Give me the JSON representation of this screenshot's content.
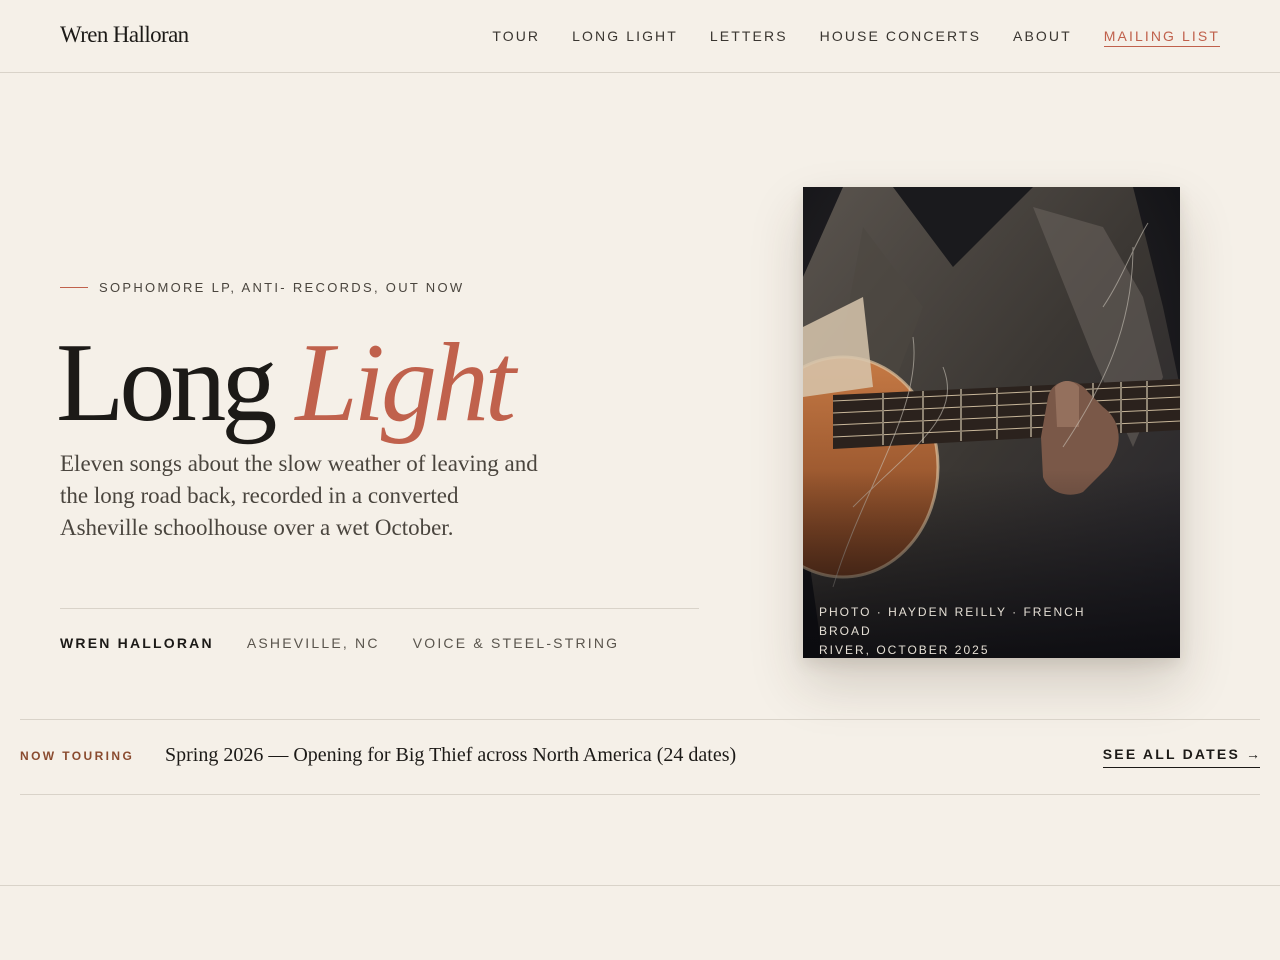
{
  "header": {
    "brand": "Wren Halloran",
    "nav": [
      {
        "label": "TOUR"
      },
      {
        "label": "LONG LIGHT"
      },
      {
        "label": "LETTERS"
      },
      {
        "label": "HOUSE CONCERTS"
      },
      {
        "label": "ABOUT"
      },
      {
        "label": "MAILING LIST"
      }
    ]
  },
  "hero": {
    "eyebrow": "SOPHOMORE LP, ANTI- RECORDS, OUT NOW",
    "title_main": "Long",
    "title_accent": "Light",
    "description": "Eleven songs about the slow weather of leaving and the long road back, recorded in a converted Asheville schoolhouse over a wet October.",
    "meta": {
      "artist": "WREN HALLORAN",
      "location": "ASHEVILLE, NC",
      "instrument": "VOICE & STEEL-STRING"
    }
  },
  "photo": {
    "credit_line1": "PHOTO · HAYDEN REILLY · FRENCH BROAD",
    "credit_line2": "RIVER, OCTOBER 2025"
  },
  "tour": {
    "label": "NOW TOURING",
    "text": "Spring 2026 — Opening for Big Thief across North America (24 dates)",
    "link": "SEE ALL DATES",
    "link_icon": "arrow-right-icon"
  },
  "colors": {
    "background": "#f5f0e8",
    "accent": "#c0614c",
    "text": "#1c1a17",
    "muted": "#4a453e",
    "rule": "#d9d3c9",
    "tour_label": "#8a4b2f"
  }
}
